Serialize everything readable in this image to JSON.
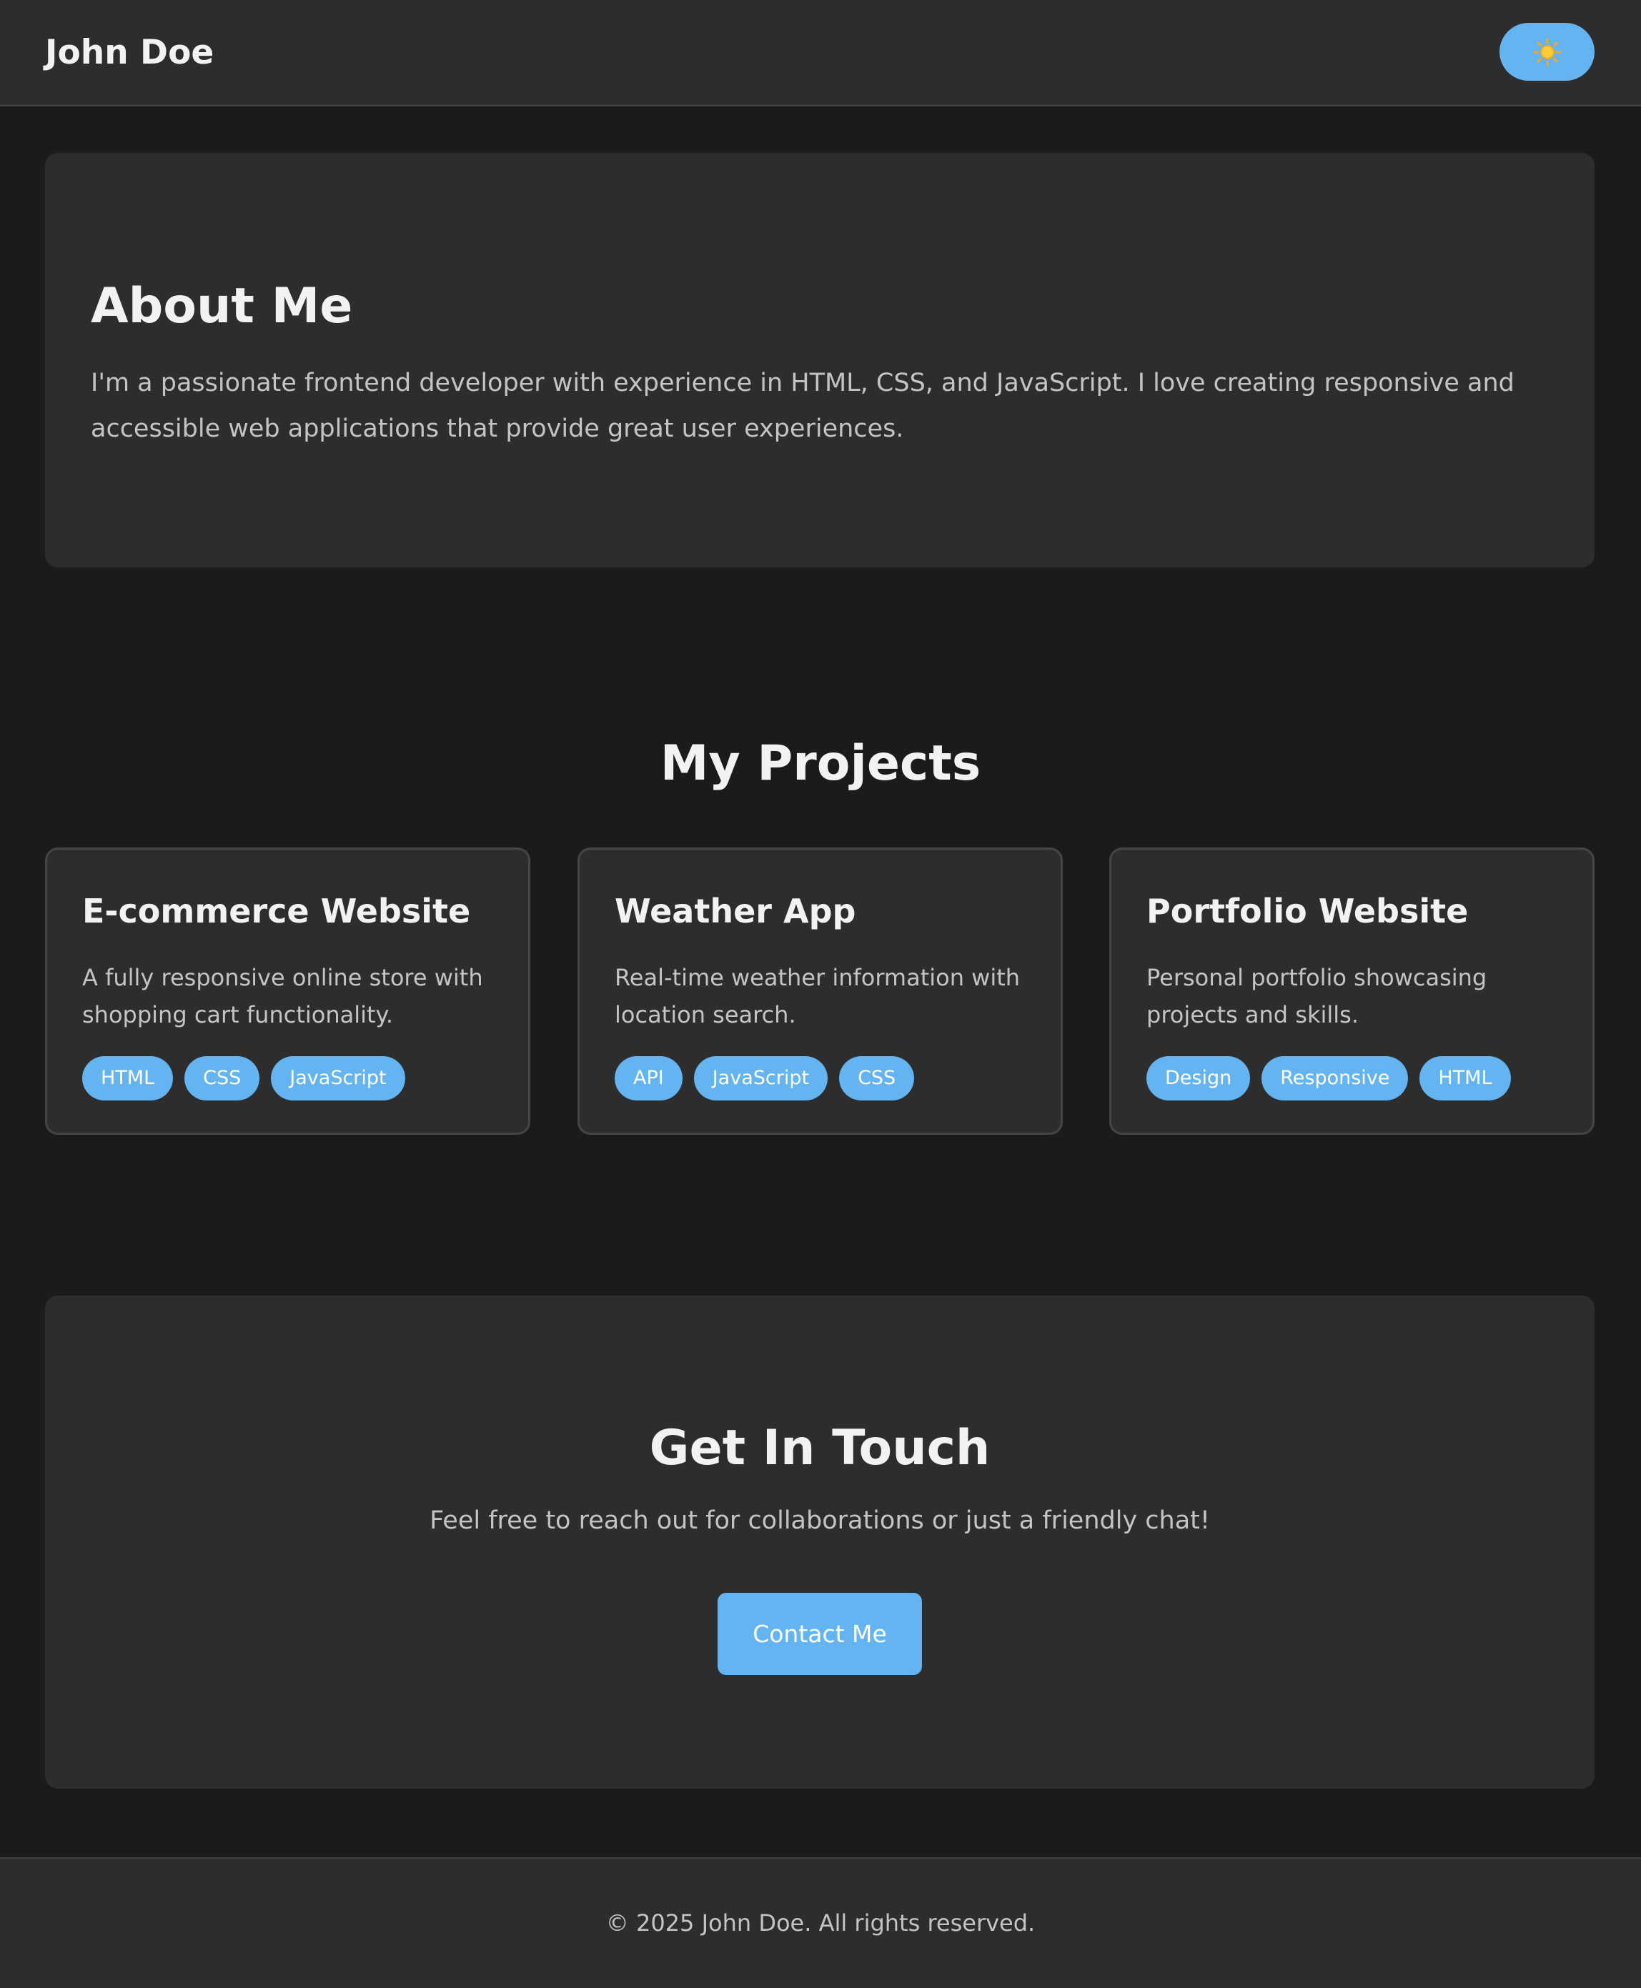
{
  "header": {
    "brand": "John Doe",
    "theme_toggle_icon": "sun-icon"
  },
  "about": {
    "title": "About Me",
    "text": "I'm a passionate frontend developer with experience in HTML, CSS, and JavaScript. I love creating responsive and accessible web applications that provide great user experiences."
  },
  "projects": {
    "title": "My Projects",
    "items": [
      {
        "title": "E-commerce Website",
        "description": "A fully responsive online store with shopping cart functionality.",
        "tags": [
          "HTML",
          "CSS",
          "JavaScript"
        ]
      },
      {
        "title": "Weather App",
        "description": "Real-time weather information with location search.",
        "tags": [
          "API",
          "JavaScript",
          "CSS"
        ]
      },
      {
        "title": "Portfolio Website",
        "description": "Personal portfolio showcasing projects and skills.",
        "tags": [
          "Design",
          "Responsive",
          "HTML"
        ]
      }
    ]
  },
  "contact": {
    "title": "Get In Touch",
    "text": "Feel free to reach out for collaborations or just a friendly chat!",
    "button_label": "Contact Me"
  },
  "footer": {
    "text": "© 2025 John Doe. All rights reserved."
  },
  "colors": {
    "accent": "#63b4f1",
    "page_background": "#1b1b1b",
    "surface": "#2d2d2d",
    "text": "#f2f2f2",
    "muted_text": "#c4c4c4"
  }
}
